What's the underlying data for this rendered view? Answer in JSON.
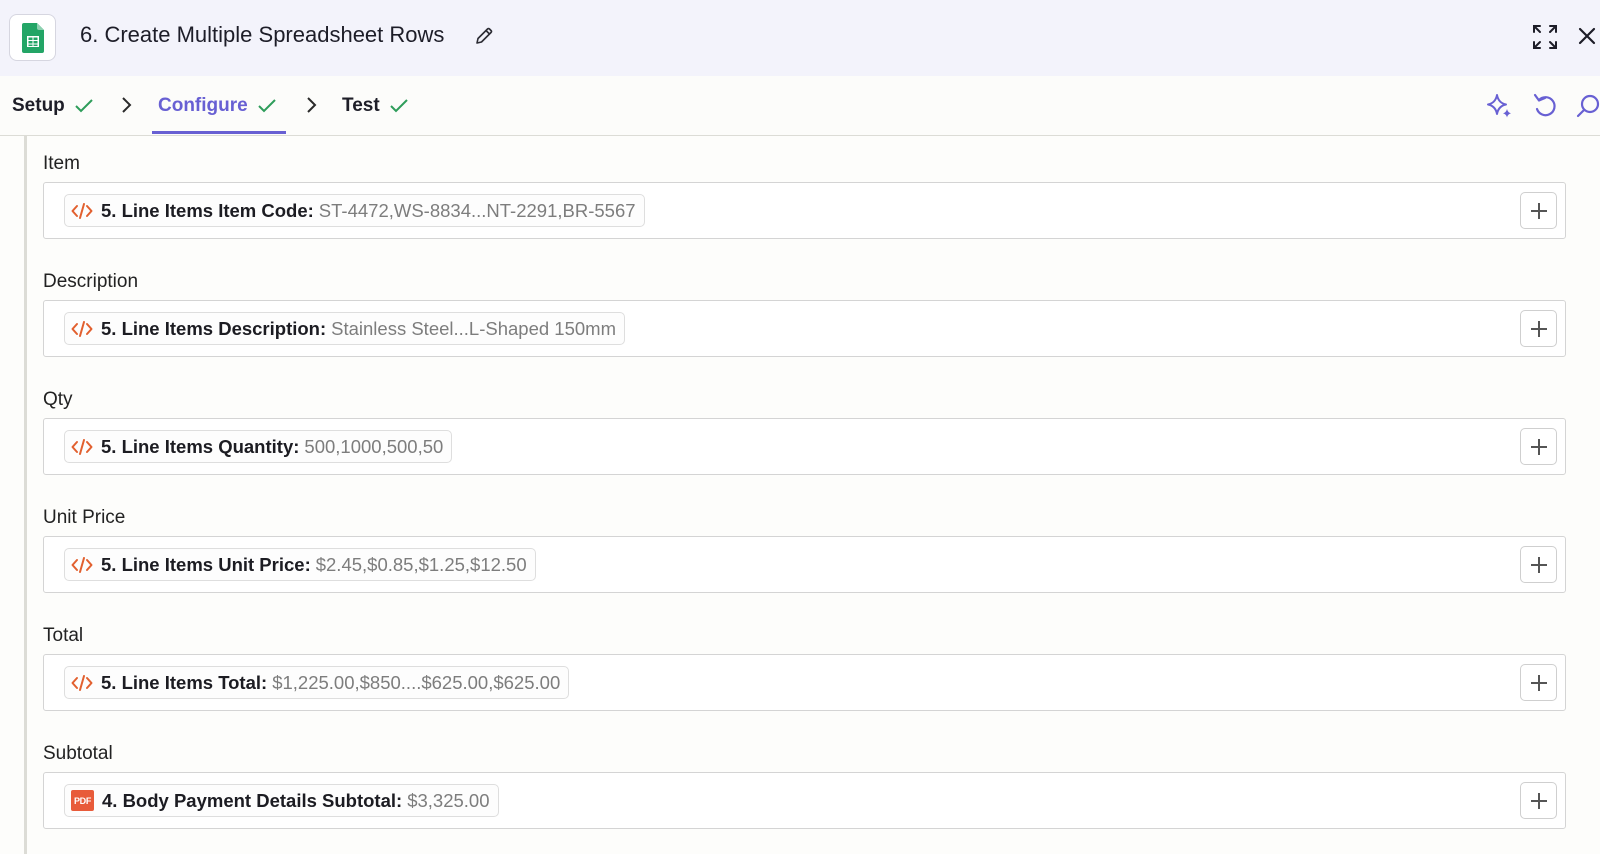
{
  "header": {
    "title": "6. Create Multiple Spreadsheet Rows",
    "app_icon": "google-sheets-icon",
    "accent_color": "#6860d3"
  },
  "tabs": [
    {
      "label": "Setup",
      "complete": true
    },
    {
      "label": "Configure",
      "complete": true,
      "active": true
    },
    {
      "label": "Test",
      "complete": true
    }
  ],
  "toolbar_icons": [
    "ai-sparkle-icon",
    "undo-icon",
    "search-icon"
  ],
  "fields": [
    {
      "label": "Item",
      "source": "code",
      "key": "5. Line Items Item Code:",
      "value": "ST-4472,WS-8834...NT-2291,BR-5567"
    },
    {
      "label": "Description",
      "source": "code",
      "key": "5. Line Items Description:",
      "value": "Stainless Steel...L-Shaped 150mm"
    },
    {
      "label": "Qty",
      "source": "code",
      "key": "5. Line Items Quantity:",
      "value": "500,1000,500,50"
    },
    {
      "label": "Unit Price",
      "source": "code",
      "key": "5. Line Items Unit Price:",
      "value": "$2.45,$0.85,$1.25,$12.50"
    },
    {
      "label": "Total",
      "source": "code",
      "key": "5. Line Items Total:",
      "value": "$1,225.00,$850....$625.00,$625.00"
    },
    {
      "label": "Subtotal",
      "source": "pdf",
      "source_label": "PDF",
      "key": "4. Body Payment Details Subtotal:",
      "value": "$3,325.00"
    }
  ]
}
